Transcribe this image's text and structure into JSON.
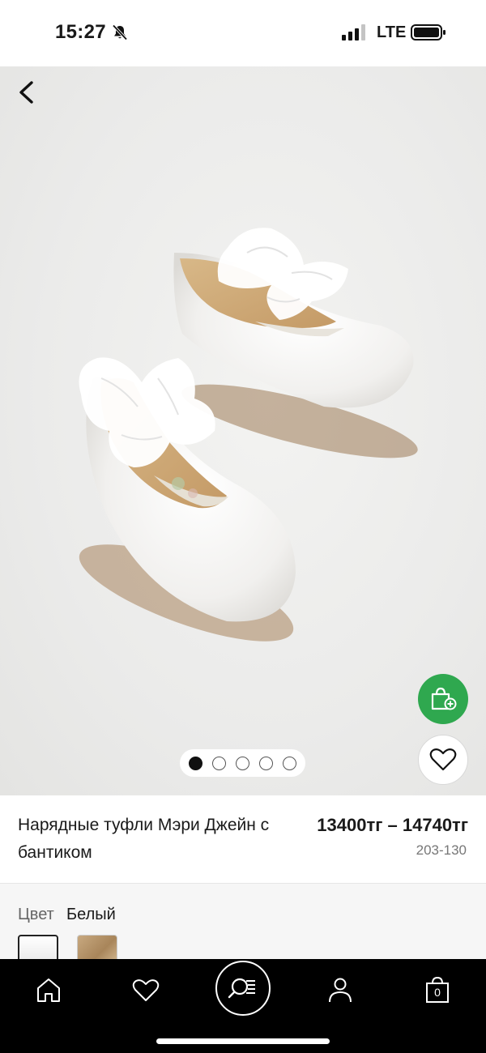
{
  "status_bar": {
    "time": "15:27",
    "network": "LTE",
    "icons": [
      "bell-muted-icon",
      "signal-icon",
      "battery-icon"
    ]
  },
  "hero": {
    "icons": [
      "back-arrow-icon",
      "cart-add-icon",
      "heart-icon"
    ],
    "image_count": 5,
    "active_image": 1,
    "colors": {
      "fab_green": "#2fa84f",
      "background": "#ededeb"
    }
  },
  "product": {
    "title": "Нарядные туфли Мэри Джейн с бантиком",
    "price": "13400тг – 14740тг",
    "code": "203-130"
  },
  "color": {
    "label": "Цвет",
    "value": "Белый",
    "swatches": [
      "white",
      "gold"
    ]
  },
  "bottom_nav": {
    "items": [
      "home-icon",
      "heart-icon",
      "search-list-icon",
      "account-icon",
      "bag-icon"
    ],
    "bag_count": "0"
  }
}
